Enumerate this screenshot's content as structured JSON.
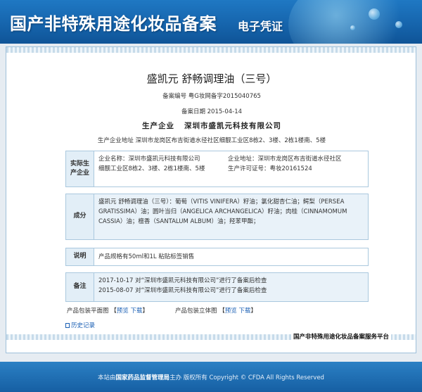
{
  "banner": {
    "title": "国产非特殊用途化妆品备案",
    "subtitle": "电子凭证"
  },
  "product": {
    "name": "盛凯元 舒畅调理油（三号）",
    "reg_no": "备案编号  粤G妆网备字2015040765",
    "date": "备案日期    2015-04-14",
    "maker_label": "生产企业",
    "maker_name": "深圳市盛凯元科技有限公司",
    "maker_addr": "生产企业地址    深圳市龙岗区布吉街道水径社区细靓工业区8栋2、3楼、2栋1楼南、5楼"
  },
  "enterprise": {
    "label": "实际生产企业",
    "name": "企业名称：深圳市盛凯元科技有限公司",
    "addr_a": "企业地址：深圳市龙岗区布吉街道水径社区",
    "addr_b": "细靓工业区8栋2、3楼、2栋1楼南、5楼",
    "license": "生产许可证号：粤妆20161524"
  },
  "ingredients": {
    "label": "成分",
    "text": "盛凯元 舒畅调理油（三号）：葡萄（VITIS VINIFERA）籽油；氯化甜杏仁油；鳄梨（PERSEA GRATISSIMA）油；圆叶当归（ANGELICA ARCHANGELICA）籽油；肉桂（CINNAMOMUM CASSIA）油；檀香（SANTALUM ALBUM）油；羟苯甲酯；"
  },
  "notes": {
    "label": "说明",
    "text": "产品规格有50ml和1L 粘贴标签销售"
  },
  "remarks": {
    "label": "备注",
    "items": [
      "2017-10-17 对“深圳市盛凯元科技有限公司”进行了备案后检查",
      "2015-08-07 对“深圳市盛凯元科技有限公司”进行了备案后检查"
    ]
  },
  "packaging": {
    "plan_label": "产品包装平面图",
    "stereo_label": "产品包装立体图",
    "preview": "预览",
    "download": "下载",
    "open_bracket": "【",
    "close_bracket": "】"
  },
  "history": "历史记录",
  "platform": "国产非特殊用途化妆品备案服务平台",
  "footer": {
    "prefix": "本站由",
    "org": "国家药品监督管理局",
    "suffix": "主办 版权所有 Copyright © CFDA All Rights Reserved"
  },
  "colors": {
    "banner": "#1665ad",
    "label_bg": "#e2eef7",
    "link": "#1a5fb4"
  }
}
